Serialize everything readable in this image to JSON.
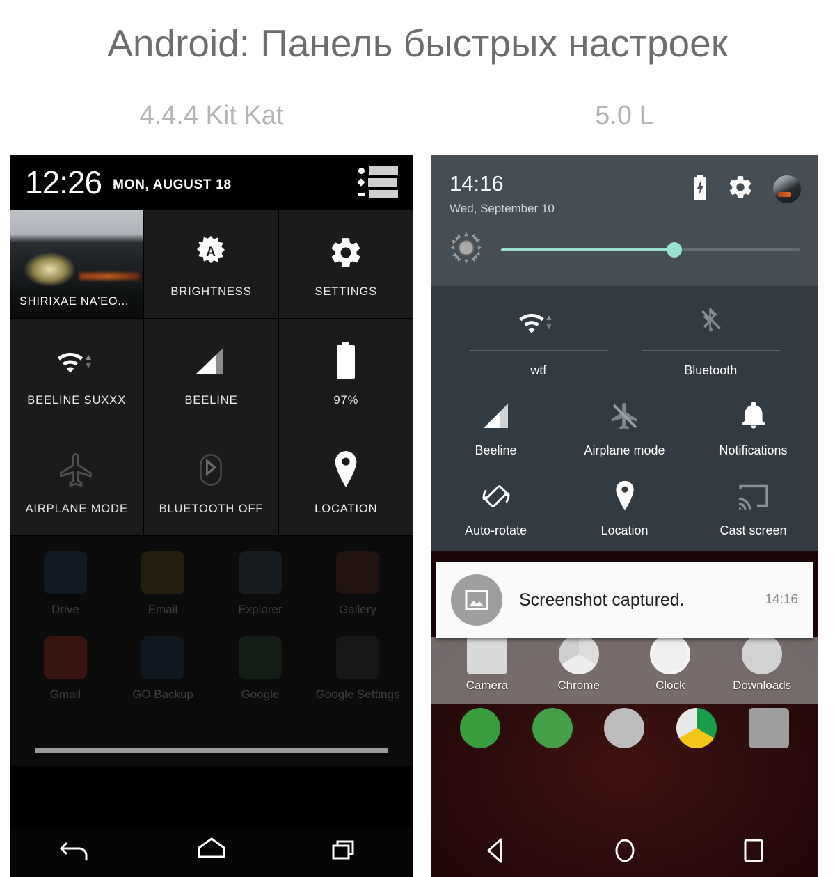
{
  "header": {
    "title": "Android: Панель быстрых настроек",
    "left_version": "4.4.4 Kit Kat",
    "right_version": "5.0 L"
  },
  "kitkat": {
    "status_bar": {
      "clock": "12:26",
      "date": "MON, AUGUST 18",
      "list_icon": "notification-list-icon"
    },
    "tiles": [
      {
        "label": "SHIRIXAE NA'EO...",
        "icon": "user-profile-photo",
        "state": "photo"
      },
      {
        "label": "BRIGHTNESS",
        "icon": "auto-brightness-icon",
        "state": "on"
      },
      {
        "label": "SETTINGS",
        "icon": "gear-icon",
        "state": "on"
      },
      {
        "label": "BEELINE SUXXX",
        "icon": "wifi-icon",
        "state": "on"
      },
      {
        "label": "BEELINE",
        "icon": "cellular-signal-icon",
        "state": "on"
      },
      {
        "label": "97%",
        "icon": "battery-icon",
        "state": "on"
      },
      {
        "label": "AIRPLANE MODE",
        "icon": "airplane-icon",
        "state": "off"
      },
      {
        "label": "BLUETOOTH OFF",
        "icon": "bluetooth-icon",
        "state": "off"
      },
      {
        "label": "LOCATION",
        "icon": "location-pin-icon",
        "state": "on"
      }
    ],
    "drawer_apps": [
      {
        "label": "Drive",
        "color": "#3d7ac4"
      },
      {
        "label": "Email",
        "color": "#c9a227"
      },
      {
        "label": "Explorer",
        "color": "#6f8fae"
      },
      {
        "label": "Gallery",
        "color": "#c04a3a"
      },
      {
        "label": "Gmail",
        "color": "#d93025"
      },
      {
        "label": "GO Backup",
        "color": "#2f6fb0"
      },
      {
        "label": "Google",
        "color": "#4a8f5e"
      },
      {
        "label": "Google Settings",
        "color": "#5a6b78"
      }
    ],
    "nav": [
      {
        "name": "back-button"
      },
      {
        "name": "home-button"
      },
      {
        "name": "recents-button"
      }
    ]
  },
  "lollipop": {
    "status_bar": {
      "clock": "14:16",
      "date": "Wed, September 10",
      "battery_icon": "battery-charging-icon",
      "settings_icon": "gear-icon",
      "avatar": "user-avatar"
    },
    "brightness": {
      "icon": "brightness-sun-icon",
      "value_percent": 58,
      "accent_color": "#9ae0d2",
      "track_color": "#646c73"
    },
    "connectivity": [
      {
        "label": "wtf",
        "icon": "wifi-icon",
        "state": "on"
      },
      {
        "label": "Bluetooth",
        "icon": "bluetooth-disabled-icon",
        "state": "off"
      }
    ],
    "tiles": [
      {
        "label": "Beeline",
        "icon": "cellular-signal-icon",
        "state": "on"
      },
      {
        "label": "Airplane mode",
        "icon": "airplane-off-icon",
        "state": "off"
      },
      {
        "label": "Notifications",
        "icon": "bell-icon",
        "state": "on"
      },
      {
        "label": "Auto-rotate",
        "icon": "auto-rotate-icon",
        "state": "on"
      },
      {
        "label": "Location",
        "icon": "location-pin-icon",
        "state": "on"
      },
      {
        "label": "Cast screen",
        "icon": "cast-screen-icon",
        "state": "off"
      }
    ],
    "notification": {
      "title": "Screenshot captured.",
      "time": "14:16",
      "icon": "image-icon"
    },
    "dock_apps": [
      {
        "label": "Camera",
        "color": "#d8d8d8"
      },
      {
        "label": "Chrome",
        "color": "#e0e0e0"
      },
      {
        "label": "Clock",
        "color": "#efefef"
      },
      {
        "label": "Downloads",
        "color": "#d2d2d2"
      }
    ],
    "home_apps": [
      {
        "name": "phone-app",
        "color": "#3a9e3f"
      },
      {
        "name": "messaging-app",
        "color": "#43a047"
      },
      {
        "name": "app-drawer",
        "color": "#bdbdbd"
      },
      {
        "name": "chrome-app",
        "color": "#e8e8e8"
      },
      {
        "name": "gmail-app",
        "color": "#9e9e9e"
      }
    ],
    "nav": [
      {
        "name": "back-button"
      },
      {
        "name": "home-button"
      },
      {
        "name": "recents-button"
      }
    ]
  }
}
